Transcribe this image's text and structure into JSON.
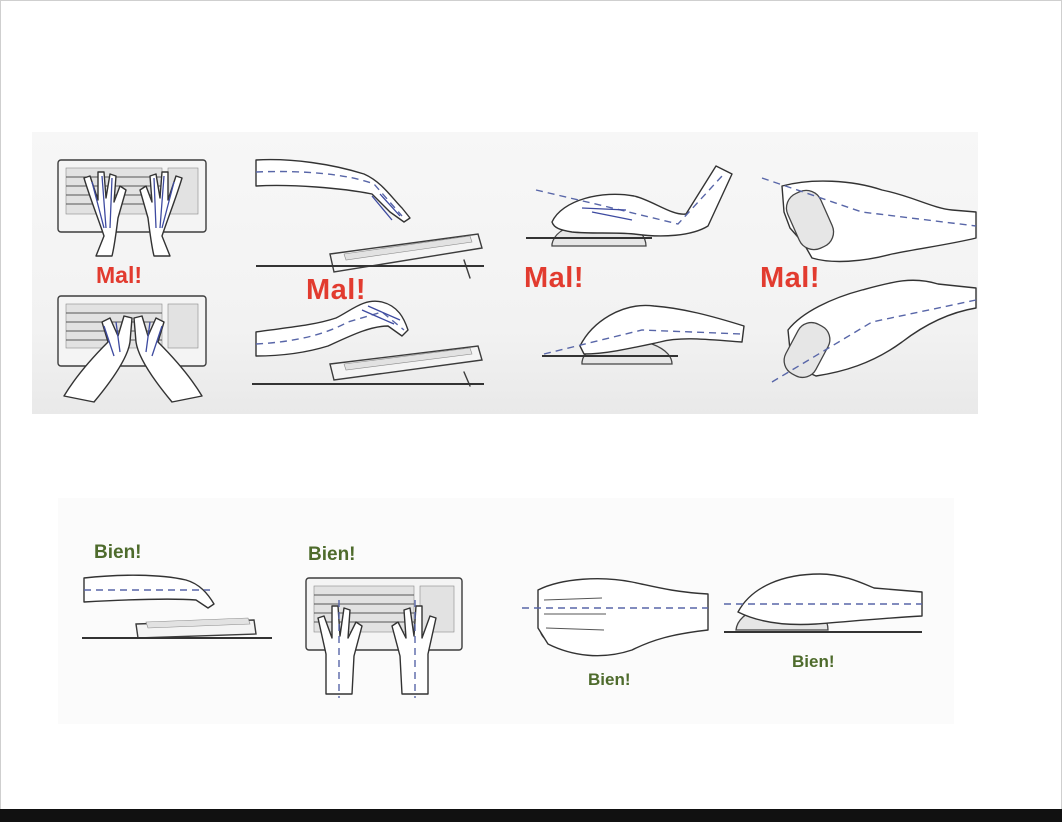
{
  "labels": {
    "keyboard_top_wrong": "Mal!",
    "keyboard_side_wrong": "Mal!",
    "mouse_side_wrong": "Mal!",
    "mouse_top_wrong": "Mal!",
    "keyboard_side_right": "Bien!",
    "keyboard_top_right": "Bien!",
    "mouse_top_right": "Bien!",
    "mouse_side_right": "Bien!"
  },
  "colors": {
    "wrong_label": "#e23b2f",
    "right_label": "#4e6b2c",
    "guide_line": "#5866a8",
    "frame_bar": "#111111"
  }
}
